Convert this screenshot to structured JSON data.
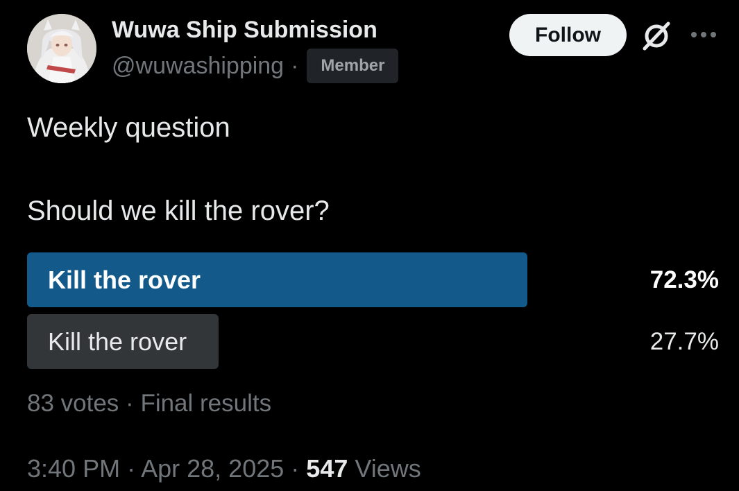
{
  "author": {
    "display_name": "Wuwa Ship Submission",
    "handle": "@wuwashipping",
    "separator": "·",
    "badge": "Member",
    "avatar_icon": "anime-character-avatar"
  },
  "actions": {
    "follow_label": "Follow",
    "grok_icon": "grok-slash-icon",
    "more_icon": "more-dots-icon"
  },
  "post": {
    "line_1": "Weekly question",
    "line_2": "Should we kill the rover?"
  },
  "poll": {
    "options": [
      {
        "label": "Kill the rover",
        "percent": "72.3%",
        "fraction": 0.723,
        "winner": true
      },
      {
        "label": "Kill the rover",
        "percent": "27.7%",
        "fraction": 0.277,
        "winner": false
      }
    ],
    "votes": "83 votes",
    "separator": "·",
    "status": "Final results",
    "colors": {
      "winner_bar": "#135a8a",
      "other_bar": "#333639"
    }
  },
  "meta": {
    "time": "3:40 PM",
    "date": "Apr 28, 2025",
    "separator": "·",
    "views_count": "547",
    "views_label": "Views"
  }
}
